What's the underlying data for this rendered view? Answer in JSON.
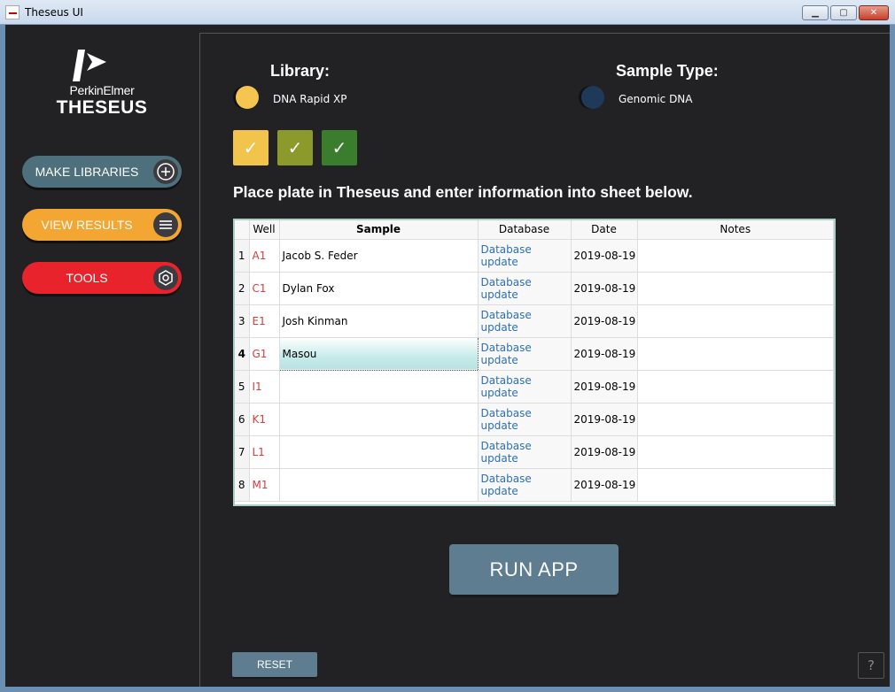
{
  "window": {
    "title": "Theseus UI",
    "min": "▁",
    "max": "▢",
    "close": "✕"
  },
  "brand": {
    "company": "PerkinElmer",
    "product": "THESEUS"
  },
  "sidebar": {
    "items": [
      {
        "label": "MAKE LIBRARIES",
        "icon": "plus-circle-icon",
        "color": "#4e6f7c"
      },
      {
        "label": "VIEW RESULTS",
        "icon": "menu-icon",
        "color": "#f3a631"
      },
      {
        "label": "TOOLS",
        "icon": "hex-nut-icon",
        "color": "#e8232c"
      }
    ]
  },
  "library": {
    "title": "Library:",
    "value": "DNA Rapid XP",
    "color": "#f4c550"
  },
  "sample_type": {
    "title": "Sample Type:",
    "value": "Genomic DNA",
    "color": "#1f3a58"
  },
  "steps": [
    {
      "mark": "✓",
      "color": "#f2c44c"
    },
    {
      "mark": "✓",
      "color": "#8c9a2c"
    },
    {
      "mark": "✓",
      "color": "#3a7d2c"
    }
  ],
  "instruction": "Place plate in Theseus and enter information into sheet below.",
  "table": {
    "headers": {
      "well": "Well",
      "sample": "Sample",
      "database": "Database",
      "date": "Date",
      "notes": "Notes"
    },
    "rows": [
      {
        "num": "1",
        "well": "A1",
        "sample": "Jacob S. Feder",
        "database": "Database update",
        "date": "2019-08-19",
        "notes": ""
      },
      {
        "num": "2",
        "well": "C1",
        "sample": "Dylan Fox",
        "database": "Database update",
        "date": "2019-08-19",
        "notes": ""
      },
      {
        "num": "3",
        "well": "E1",
        "sample": "Josh Kinman",
        "database": "Database update",
        "date": "2019-08-19",
        "notes": ""
      },
      {
        "num": "4",
        "well": "G1",
        "sample": "Masou",
        "database": "Database update",
        "date": "2019-08-19",
        "notes": ""
      },
      {
        "num": "5",
        "well": "I1",
        "sample": "",
        "database": "Database update",
        "date": "2019-08-19",
        "notes": ""
      },
      {
        "num": "6",
        "well": "K1",
        "sample": "",
        "database": "Database update",
        "date": "2019-08-19",
        "notes": ""
      },
      {
        "num": "7",
        "well": "L1",
        "sample": "",
        "database": "Database update",
        "date": "2019-08-19",
        "notes": ""
      },
      {
        "num": "8",
        "well": "M1",
        "sample": "",
        "database": "Database update",
        "date": "2019-08-19",
        "notes": ""
      }
    ]
  },
  "buttons": {
    "run": "RUN APP",
    "reset": "RESET",
    "help": "?"
  }
}
